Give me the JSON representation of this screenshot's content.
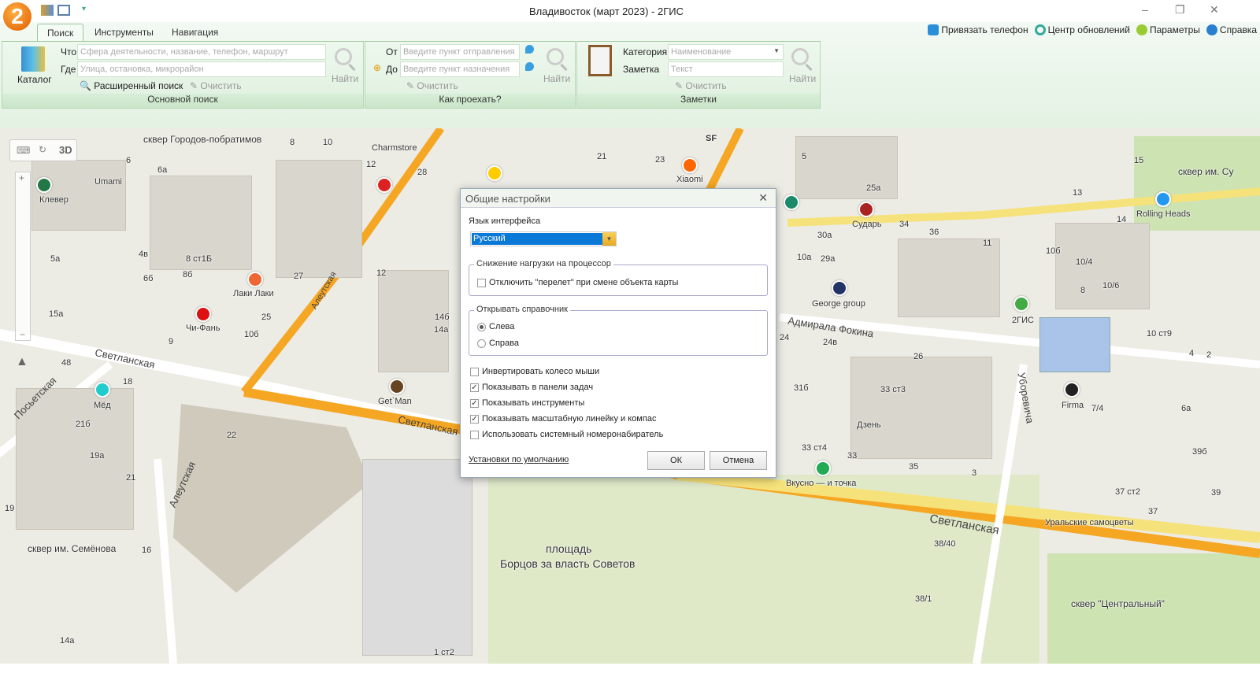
{
  "app": {
    "logo": "2",
    "title": "Владивосток (март 2023) - 2ГИС",
    "minimize": "–",
    "restore": "❐",
    "close": "✕"
  },
  "tabs": [
    {
      "label": "Поиск"
    },
    {
      "label": "Инструменты"
    },
    {
      "label": "Навигация"
    }
  ],
  "toplinks": [
    {
      "label": "Привязать телефон",
      "icon": "phone-icon"
    },
    {
      "label": "Центр обновлений",
      "icon": "refresh-icon"
    },
    {
      "label": "Параметры",
      "icon": "gear-icon"
    },
    {
      "label": "Справка",
      "icon": "help-icon"
    }
  ],
  "search": {
    "catalog": "Каталог",
    "what_label": "Что",
    "what_placeholder": "Сфера деятельности, название, телефон, маршрут",
    "where_label": "Где",
    "where_placeholder": "Улица, остановка, микрорайон",
    "find": "Найти",
    "advanced": "Расширенный поиск",
    "clear": "Очистить",
    "group": "Основной поиск"
  },
  "route": {
    "from_label": "От",
    "from_placeholder": "Введите пункт отправления",
    "to_label": "До",
    "to_placeholder": "Введите пункт назначения",
    "find": "Найти",
    "clear": "Очистить",
    "group": "Как проехать?"
  },
  "notes": {
    "category_label": "Категория",
    "category_value": "Наименование",
    "note_label": "Заметка",
    "note_placeholder": "Текст",
    "find": "Найти",
    "clear": "Очистить",
    "group": "Заметки"
  },
  "map": {
    "mode3d": "3D",
    "labels": [
      "сквер Городов-побратимов",
      "Charmstore",
      "Xiaomi",
      "SF",
      "Umami",
      "Клевер",
      "Лаки Лаки",
      "Чи-Фань",
      "Мёд",
      "Get`Man",
      "Сударь",
      "George group",
      "2ГИС",
      "Rolling Heads",
      "сквер им. Су",
      "Firma",
      "Дзень",
      "Вкусно — и точка",
      "Уральские самоцветы",
      "сквер им. Семёнова",
      "сквер \"Центральный\"",
      "площадь",
      "Борцов за власть Советов"
    ],
    "streets": [
      "Светланская",
      "Светланская",
      "Светланская",
      "Алеутская",
      "Алеутская",
      "Посьетская",
      "Адмирала Фокина",
      "Уборевича"
    ],
    "numbers": [
      "6",
      "6а",
      "10",
      "8",
      "28",
      "12",
      "21",
      "23",
      "25а",
      "15",
      "14",
      "36",
      "34",
      "11",
      "30а",
      "29а",
      "10а",
      "13",
      "12",
      "10б",
      "10/4",
      "10/6",
      "8",
      "24",
      "24в",
      "26",
      "33 ст3",
      "31б",
      "33 ст4",
      "33",
      "35",
      "3",
      "5",
      "15а",
      "14а",
      "14б",
      "27",
      "25",
      "10б",
      "9",
      "8 ст1Б",
      "8б",
      "6б",
      "4в",
      "5а",
      "48",
      "18",
      "21б",
      "19а",
      "22",
      "21",
      "16",
      "19",
      "14а",
      "1 ст2",
      "38/40",
      "38/1",
      "37 ст2",
      "37",
      "39",
      "39б",
      "6а",
      "4",
      "7/4",
      "10 ст9",
      "2"
    ]
  },
  "dialog": {
    "title": "Общие настройки",
    "lang_label": "Язык интерфейса",
    "lang_value": "Русский",
    "cpu_group": "Снижение нагрузки на процессор",
    "cpu_option": "Отключить \"перелет\" при смене объекта карты",
    "cpu_checked": false,
    "open_group": "Открывать справочник",
    "left": "Слева",
    "right": "Справа",
    "selected": "Слева",
    "options": [
      {
        "label": "Инвертировать колесо мыши",
        "checked": false
      },
      {
        "label": "Показывать в панели задач",
        "checked": true
      },
      {
        "label": "Показывать инструменты",
        "checked": true
      },
      {
        "label": "Показывать масштабную линейку и компас",
        "checked": true
      },
      {
        "label": "Использовать системный номеронабиратель",
        "checked": false
      }
    ],
    "defaults": "Установки по умолчанию",
    "ok": "ОК",
    "cancel": "Отмена",
    "close": "✕"
  },
  "colors": {
    "accent": "#e05a00",
    "ribbon": "#e3f2e3",
    "main_road": "#f5a623",
    "street": "#f6e27a",
    "selection": "#0a78d7"
  }
}
